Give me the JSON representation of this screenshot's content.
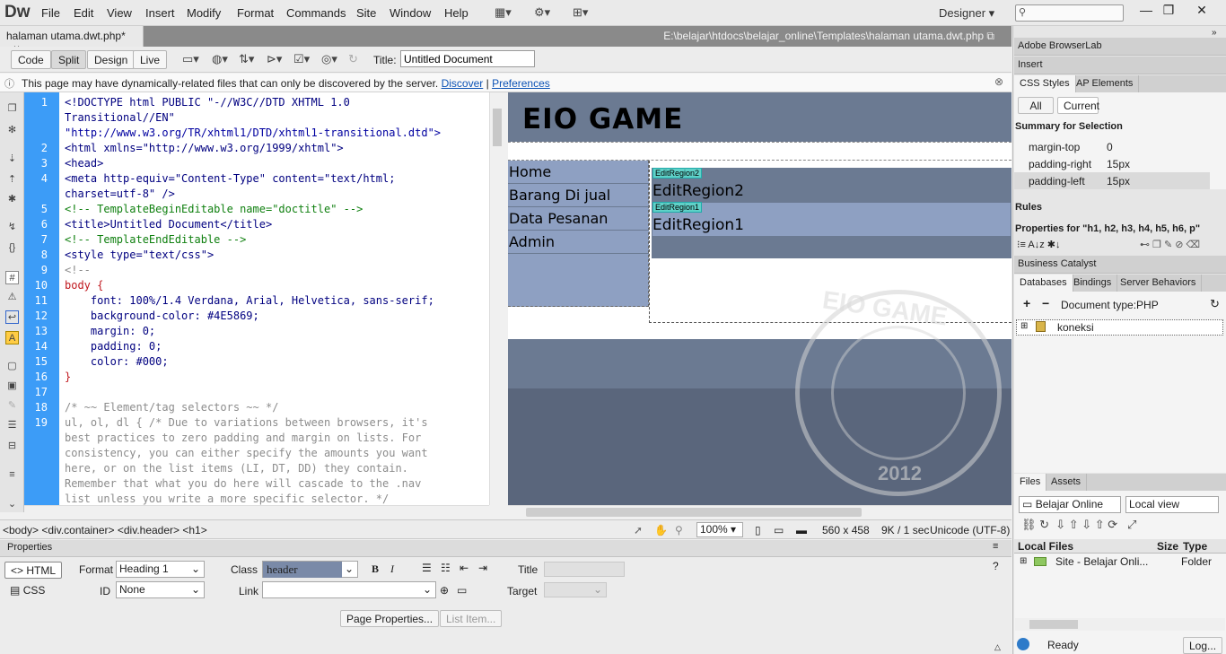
{
  "app": {
    "logo": "Dw",
    "workspace": "Designer"
  },
  "menu": [
    "File",
    "Edit",
    "View",
    "Insert",
    "Modify",
    "Format",
    "Commands",
    "Site",
    "Window",
    "Help"
  ],
  "document": {
    "tab_label": "halaman utama.dwt.php*",
    "file_path": "E:\\belajar\\htdocs\\belajar_online\\Templates\\halaman utama.dwt.php",
    "title_label": "Title:",
    "title_value": "Untitled Document"
  },
  "view_buttons": {
    "code": "Code",
    "split": "Split",
    "design": "Design",
    "live": "Live"
  },
  "infobar": {
    "text": "This page may have dynamically-related files that can only be discovered by the server.",
    "link1": "Discover",
    "link2": "Preferences"
  },
  "code": {
    "line_numbers": [
      "1",
      "2",
      "3",
      "4",
      "5",
      "6",
      "7",
      "8",
      "9",
      "10",
      "11",
      "12",
      "13",
      "14",
      "15",
      "16",
      "17",
      "18",
      "19"
    ],
    "lines": [
      "<!DOCTYPE html PUBLIC \"-//W3C//DTD XHTML 1.0",
      "Transitional//EN\"",
      "\"http://www.w3.org/TR/xhtml1/DTD/xhtml1-transitional.dtd\">",
      "<html xmlns=\"http://www.w3.org/1999/xhtml\">",
      "<head>",
      "<meta http-equiv=\"Content-Type\" content=\"text/html;",
      "charset=utf-8\" />",
      "<!-- TemplateBeginEditable name=\"doctitle\" -->",
      "<title>Untitled Document</title>",
      "<!-- TemplateEndEditable -->",
      "<style type=\"text/css\">",
      "<!--",
      "body {",
      "    font: 100%/1.4 Verdana, Arial, Helvetica, sans-serif;",
      "    background-color: #4E5869;",
      "    margin: 0;",
      "    padding: 0;",
      "    color: #000;",
      "}",
      "",
      "/* ~~ Element/tag selectors ~~ */",
      "ul, ol, dl { /* Due to variations between browsers, it's",
      "best practices to zero padding and margin on lists. For",
      "consistency, you can either specify the amounts you want",
      "here, or on the list items (LI, DT, DD) they contain.",
      "Remember that what you do here will cascade to the .nav",
      "list unless you write a more specific selector. */"
    ]
  },
  "design": {
    "heading": "EIO GAME",
    "nav": [
      "Home",
      "Barang Di jual",
      "Data Pesanan",
      "Admin"
    ],
    "region2_tag": "EditRegion2",
    "region2_text": "EditRegion2",
    "region1_tag": "EditRegion1",
    "region1_text": "EditRegion1",
    "watermark_title": "EIO GAME",
    "watermark_year": "2012"
  },
  "status": {
    "tag_selector": "<body> <div.container> <div.header> <h1>",
    "zoom": "100%",
    "size": "560 x 458",
    "download": "9K / 1 sec",
    "encoding": "Unicode (UTF-8)"
  },
  "properties": {
    "panel_title": "Properties",
    "html_btn": "HTML",
    "css_btn": "CSS",
    "format_label": "Format",
    "format_value": "Heading 1",
    "class_label": "Class",
    "class_value": "header",
    "id_label": "ID",
    "id_value": "None",
    "link_label": "Link",
    "title_label": "Title",
    "target_label": "Target",
    "page_props": "Page Properties...",
    "list_item": "List Item..."
  },
  "right": {
    "browserlab": "Adobe BrowserLab",
    "insert": "Insert",
    "css_tab": "CSS Styles",
    "ap_tab": "AP Elements",
    "all_btn": "All",
    "current_btn": "Current",
    "summary": "Summary for Selection",
    "props": [
      {
        "name": "margin-top",
        "value": "0"
      },
      {
        "name": "padding-right",
        "value": "15px"
      },
      {
        "name": "padding-left",
        "value": "15px"
      }
    ],
    "rules": "Rules",
    "props_for": "Properties for \"h1, h2, h3, h4, h5, h6, p\"",
    "business": "Business Catalyst",
    "db_tab": "Databases",
    "bind_tab": "Bindings",
    "server_tab": "Server Behaviors",
    "doctype": "Document type:PHP",
    "connection": "koneksi",
    "files_tab": "Files",
    "assets_tab": "Assets",
    "site_select": "Belajar Online",
    "view_select": "Local view",
    "local_files": "Local Files",
    "size_col": "Size",
    "type_col": "Type",
    "site_row": "Site - Belajar Onli...",
    "site_type": "Folder",
    "ready": "Ready",
    "log_btn": "Log..."
  }
}
